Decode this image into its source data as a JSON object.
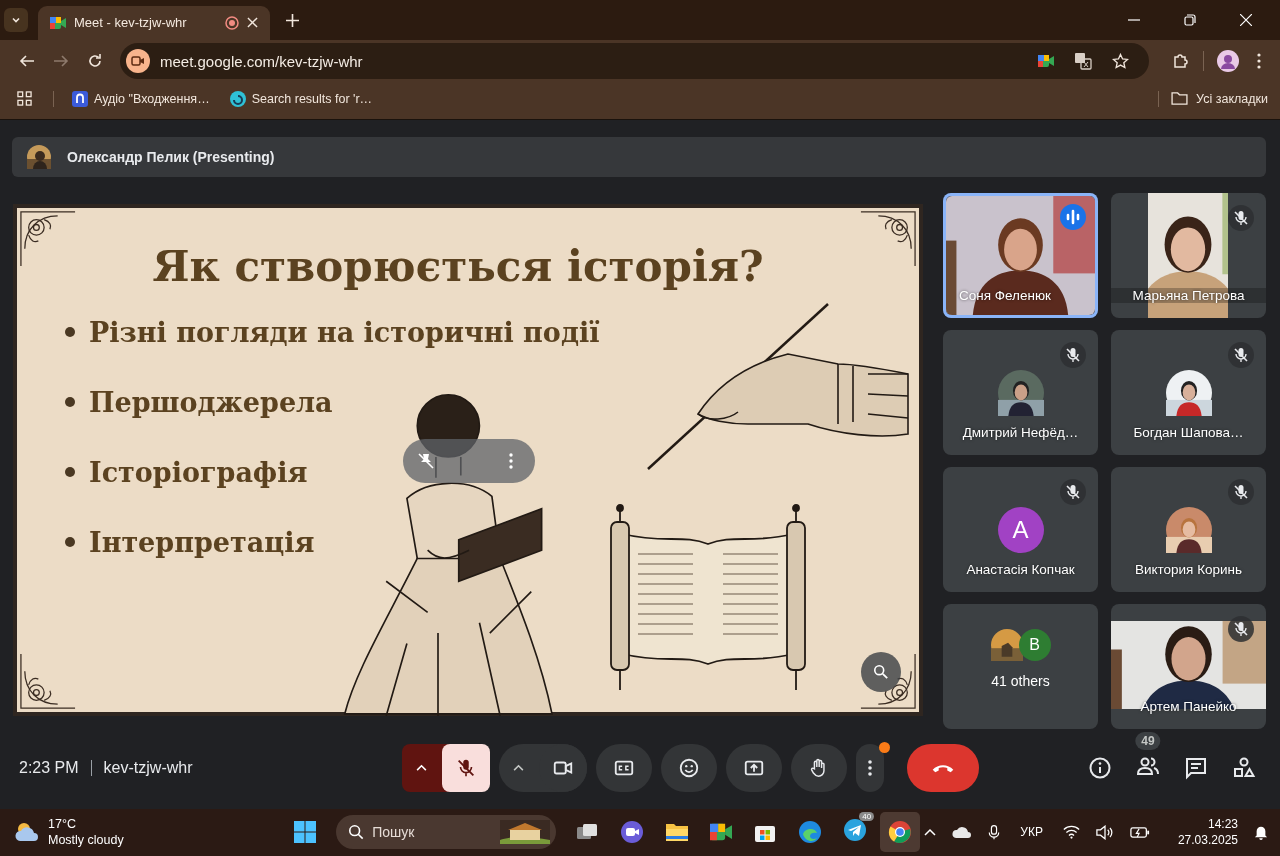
{
  "browser": {
    "tab": {
      "title": "Meet - kev-tzjw-whr"
    },
    "address": "meet.google.com/kev-tzjw-whr",
    "bookmarks": [
      {
        "label": "Аудіо \"Входження…"
      },
      {
        "label": "Search results for 'r…"
      }
    ],
    "bookmarks_folder": "Усі закладки"
  },
  "meet": {
    "presenter": "Олександр Пелик (Presenting)",
    "slide": {
      "title": "Як створюється історія?",
      "bullets": [
        "Різні погляди на історичні події",
        "Першоджерела",
        "Історіографія",
        "Інтерпретація"
      ]
    },
    "participants": [
      {
        "name": "Соня Феленюк",
        "kind": "video",
        "speaking": true,
        "muted": false
      },
      {
        "name": "Марьяна Петрова",
        "kind": "video",
        "speaking": false,
        "muted": true
      },
      {
        "name": "Дмитрий Нефёд…",
        "speaking": false,
        "muted": true
      },
      {
        "name": "Богдан Шапова…",
        "speaking": false,
        "muted": true
      },
      {
        "name": "Анастасія Копчак",
        "kind": "letter",
        "letter": "A",
        "color": "#a142c4",
        "speaking": false,
        "muted": true
      },
      {
        "name": "Виктория Коринь",
        "speaking": false,
        "muted": true
      },
      {
        "name": "Артем Панейко",
        "kind": "video",
        "speaking": false,
        "muted": true
      }
    ],
    "others": {
      "label": "41 others",
      "letter": "B",
      "color": "#2e7d32"
    },
    "time": "2:23 PM",
    "meeting_code": "kev-tzjw-whr",
    "mic_muted": true,
    "people_count": "49",
    "more_notification": true
  },
  "taskbar": {
    "temperature": "17°C",
    "weather": "Mostly cloudy",
    "search_placeholder": "Пошук",
    "telegram_badge": "40",
    "language": "УКР",
    "time": "14:23",
    "date": "27.03.2025"
  }
}
